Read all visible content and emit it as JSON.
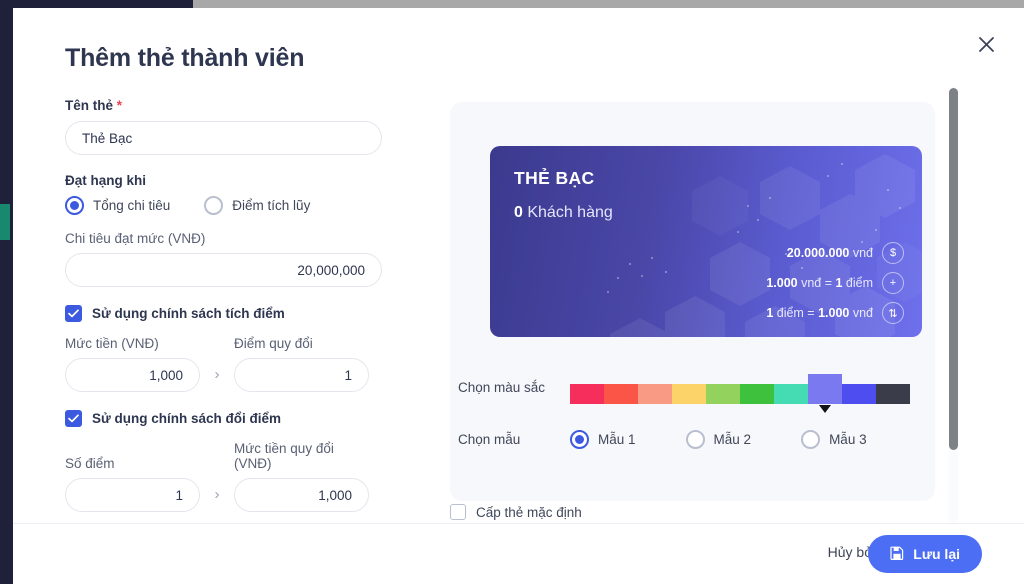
{
  "window": {
    "title": "Thêm thẻ thành viên",
    "close_icon": "close-icon"
  },
  "form": {
    "card_name": {
      "label": "Tên thẻ",
      "required_mark": "*",
      "value": "Thẻ Bạc"
    },
    "rank_condition": {
      "label": "Đạt hạng khi",
      "options": [
        {
          "label": "Tổng chi tiêu",
          "selected": true
        },
        {
          "label": "Điểm tích lũy",
          "selected": false
        }
      ]
    },
    "spend_threshold": {
      "label": "Chi tiêu đạt mức (VNĐ)",
      "value": "20,000,000"
    },
    "accrual_policy": {
      "label": "Sử dụng chính sách tích điểm",
      "checked": true,
      "money_label": "Mức tiền (VNĐ)",
      "money_value": "1,000",
      "arrow": "›",
      "points_label": "Điểm quy đổi",
      "points_value": "1"
    },
    "redeem_policy": {
      "label": "Sử dụng chính sách đổi điểm",
      "checked": true,
      "points_label": "Số điểm",
      "points_value": "1",
      "arrow": "›",
      "money_label": "Mức tiền quy đổi (VNĐ)",
      "money_value": "1,000"
    },
    "default_card": {
      "label": "Cấp thẻ mặc định",
      "checked": false
    }
  },
  "preview": {
    "card": {
      "title": "THẺ BẠC",
      "customer_count": "0",
      "customer_label": "Khách hàng",
      "stats": [
        {
          "text_html": "<b>20.000.000</b> vnđ",
          "icon": "dollar-icon",
          "glyph": "$"
        },
        {
          "text_html": "<b>1.000</b> vnđ = <b>1</b> điểm",
          "icon": "plus-icon",
          "glyph": "+"
        },
        {
          "text_html": "<b>1</b> điểm = <b>1.000</b> vnđ",
          "icon": "swap-arrows-icon",
          "glyph": "⇅"
        }
      ]
    },
    "color_picker": {
      "label": "Chọn màu sắc",
      "selected_index": 7,
      "colors": [
        "#f62e5c",
        "#fa5547",
        "#f99b84",
        "#fbd368",
        "#93d25c",
        "#3ec23e",
        "#45dcb4",
        "#7b79f0",
        "#4d4df0",
        "#3a3c49"
      ]
    },
    "template_picker": {
      "label": "Chọn mẫu",
      "options": [
        {
          "label": "Mẫu 1",
          "selected": true
        },
        {
          "label": "Mẫu 2",
          "selected": false
        },
        {
          "label": "Mẫu 3",
          "selected": false
        }
      ]
    }
  },
  "footer": {
    "cancel_label": "Hủy bỏ",
    "save_label": "Lưu lại",
    "save_icon": "save-floppy-icon"
  },
  "theme": {
    "accent": "#4c6ef5",
    "radio_accent": "#3c5ae0",
    "required": "#ef4056",
    "sidebar": "#1e2139",
    "sidebar_active": "#18886e"
  }
}
